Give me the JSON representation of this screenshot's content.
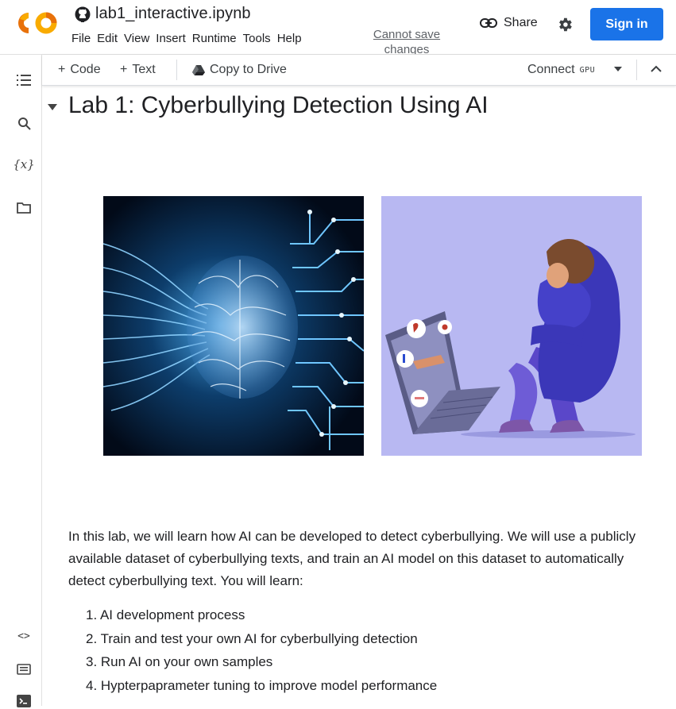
{
  "header": {
    "file_name": "lab1_interactive.ipynb",
    "menu": [
      "File",
      "Edit",
      "View",
      "Insert",
      "Runtime",
      "Tools",
      "Help"
    ],
    "save_status": "Cannot save changes",
    "share_label": "Share",
    "sign_in_label": "Sign in"
  },
  "toolbar": {
    "code_label": "Code",
    "text_label": "Text",
    "copy_to_drive_label": "Copy to Drive",
    "connect_label": "Connect",
    "runtime_type": "GPU"
  },
  "notebook": {
    "heading": "Lab 1: Cyberbullying Detection Using AI",
    "intro": "In this lab, we will learn how AI can be developed to detect cyberbullying. We will use a publicly available dataset of cyberbullying texts, and train an AI model on this dataset to automatically detect cyberbullying text. You will learn:",
    "learning_items": [
      "1. AI development process",
      "2. Train and test your own AI for cyberbullying detection",
      "3. Run AI on your own samples",
      "4. Hypterpaprameter tuning to improve model performance"
    ]
  },
  "colors": {
    "accent": "#1a73e8",
    "logo_orange": "#F9AB00",
    "logo_dark_orange": "#E8710A",
    "illustration_bg": "#b8b8f2"
  }
}
